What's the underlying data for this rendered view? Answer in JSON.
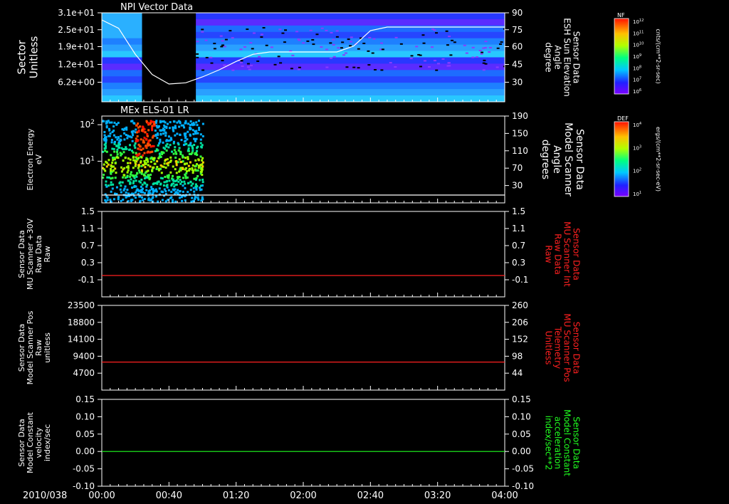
{
  "date_label": "2010/038",
  "time_ticks": [
    "00:00",
    "00:40",
    "01:20",
    "02:00",
    "02:40",
    "03:20",
    "04:00"
  ],
  "colors": {
    "axis": "#ffffff",
    "red": "#ff2020",
    "green": "#20ff20",
    "background": "#000000"
  },
  "colorbars": [
    {
      "label": "NF",
      "unit": "cnts/(cm**2-sr-sec)",
      "ticks": [
        "10^12",
        "10^11",
        "10^10",
        "10^9",
        "10^8",
        "10^7",
        "10^6"
      ]
    },
    {
      "label": "DEF",
      "unit": "ergs/(cm**2-sr-sec-eV)",
      "ticks": [
        "10^4",
        "10^3",
        "10^2",
        "10^1"
      ]
    }
  ],
  "chart_data": [
    {
      "type": "heatmap",
      "title": "NPI Vector Data",
      "ylabel": "Sector\nUnitless",
      "yticks": [
        "3.1e+01",
        "2.5e+01",
        "1.9e+01",
        "1.2e+01",
        "6.2e+00"
      ],
      "ylim": [
        0,
        31
      ],
      "right_axis": {
        "label": "Sensor Data\nESH Sun Elevation\nAngle\ndegree",
        "ticks": [
          90,
          75,
          60,
          45,
          30
        ],
        "ylim": [
          15,
          90
        ]
      },
      "series": [
        {
          "x": [
            "00:00",
            "00:10",
            "00:20",
            "00:30",
            "00:40",
            "00:50",
            "01:00",
            "01:10",
            "01:20",
            "01:30",
            "01:40",
            "01:50",
            "02:00",
            "02:10",
            "02:20",
            "02:30",
            "02:40",
            "02:50",
            "03:00",
            "03:20",
            "03:40",
            "04:00"
          ],
          "y": [
            84,
            77,
            55,
            38,
            30,
            31,
            36,
            42,
            49,
            55,
            57,
            57,
            57,
            57,
            57,
            62,
            75,
            78,
            78,
            78,
            78,
            78
          ]
        }
      ],
      "data_gap": [
        "00:24",
        "00:56"
      ]
    },
    {
      "type": "heatmap",
      "title": "MEx ELS-01 LR",
      "ylabel": "Electron Energy\neV",
      "yticks": [
        "10^2",
        "10^1"
      ],
      "right_axis": {
        "label": "Sensor Data\nModel Scanner\nAngle\ndegrees",
        "ticks": [
          190,
          150,
          110,
          70,
          30
        ],
        "ylim": [
          0,
          190
        ]
      },
      "series": [
        {
          "x": [
            "00:00",
            "01:00"
          ],
          "y": [
            12,
            12
          ]
        }
      ],
      "data_coverage": [
        "00:00",
        "01:00"
      ]
    },
    {
      "type": "line",
      "ylabel": "Sensor Data\nMU Scanner +30V\nRaw Data\nRaw",
      "yticks": [
        "1.5",
        "1.1",
        "0.7",
        "0.3",
        "-0.1"
      ],
      "ylim": [
        -0.5,
        1.5
      ],
      "right_axis": {
        "label": "Sensor Data\nMU Scanner Int\nRaw Data\nRaw",
        "ticks": [
          "1.5",
          "1.1",
          "0.7",
          "0.3",
          "-0.1"
        ],
        "ylim": [
          -0.5,
          1.5
        ]
      },
      "series": [
        {
          "x": [
            "00:00",
            "04:00"
          ],
          "y": [
            0.0,
            0.0
          ]
        }
      ]
    },
    {
      "type": "line",
      "ylabel": "Sensor Data\nModel Scanner Pos\nRaw\nunitless",
      "yticks": [
        "23500",
        "18800",
        "14100",
        "9400",
        "4700"
      ],
      "ylim": [
        0,
        23500
      ],
      "right_axis": {
        "label": "Sensor Data\nMU Scanner Pos\nTelemetry\nUnitless",
        "ticks": [
          "260",
          "206",
          "152",
          "98",
          "44"
        ],
        "ylim": [
          0,
          260
        ]
      },
      "series": [
        {
          "x": [
            "00:00",
            "04:00"
          ],
          "y": [
            86,
            86
          ]
        }
      ]
    },
    {
      "type": "line",
      "ylabel": "Sensor Data\nModel Constant\nvelocity\nindex/sec",
      "yticks": [
        "0.15",
        "0.10",
        "0.05",
        "0.00",
        "-0.05",
        "-0.10"
      ],
      "ylim": [
        -0.1,
        0.15
      ],
      "right_axis": {
        "label": "Sensor Data\nModel Constant\nacceleration\nindex/sec**2",
        "ticks": [
          "0.15",
          "0.10",
          "0.05",
          "0.00",
          "-0.05",
          "-0.10"
        ],
        "ylim": [
          -0.1,
          0.15
        ]
      },
      "series": [
        {
          "x": [
            "00:00",
            "04:00"
          ],
          "y": [
            0.0,
            0.0
          ]
        }
      ]
    }
  ]
}
